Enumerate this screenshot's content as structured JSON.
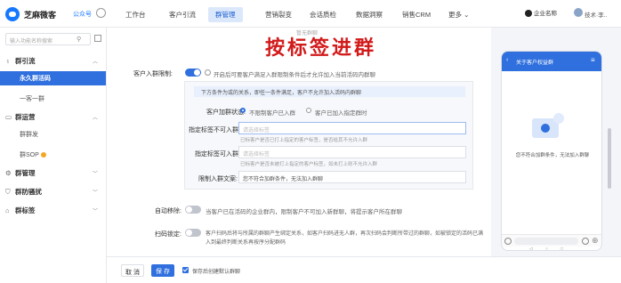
{
  "header": {
    "brand": "芝麻微客",
    "brand_sub": "公众号",
    "nav": [
      "工作台",
      "客户引流",
      "群管理",
      "营销裂变",
      "会话质检",
      "数据洞察",
      "销售CRM",
      "更多 ⌄"
    ],
    "active_nav_index": 2,
    "org": "企业名称",
    "username": "技术·李.."
  },
  "sidebar": {
    "search_placeholder": "输入功能名称搜索",
    "groups": [
      {
        "label": "群引流",
        "icon": "link-icon",
        "expanded": true,
        "items": [
          {
            "label": "永久群活码",
            "active": true
          },
          {
            "label": "一客一群",
            "active": false
          }
        ]
      },
      {
        "label": "群运营",
        "icon": "chat-icon",
        "expanded": true,
        "items": [
          {
            "label": "群群发",
            "active": false
          },
          {
            "label": "群SOP",
            "active": false
          }
        ]
      },
      {
        "label": "群管理",
        "icon": "gear-icon",
        "expanded": false,
        "items": []
      },
      {
        "label": "群防骚扰",
        "icon": "shield-icon",
        "expanded": false,
        "items": []
      },
      {
        "label": "群标签",
        "icon": "tag-icon",
        "expanded": false,
        "items": []
      }
    ]
  },
  "annotation": "按标签进群",
  "faint_label": "暂无群聊",
  "form": {
    "entry_limit": {
      "label": "客户入群限制:",
      "enabled": true,
      "hint": "开启后可要客户满足入群限制条件后才允许加入当前活码内群聊"
    },
    "panel_note": "下方条件为或的关系，即任一条件满足，客户不允许加入活码内群聊",
    "join_status": {
      "label": "客户加群状态:",
      "options": [
        "不限制客户已入群",
        "客户已加入指定群时"
      ],
      "selected": 0
    },
    "tag_not_allowed": {
      "label": "指定标签不可入群:",
      "placeholder": "请选择标签",
      "hint": "已标客户是否已打上指定的客户标签，是否给其不允许入群"
    },
    "tag_allowed": {
      "label": "指定标签可入群:",
      "placeholder": "请选择标签",
      "hint": "已标客户是否未被打上指定的客户标签，如未打上则不允许入群"
    },
    "deny_text": {
      "label": "限制入群文案:",
      "value": "您不符合加群条件，无法加入群聊"
    },
    "auto_remove": {
      "label": "自动移除:",
      "enabled": false,
      "hint": "当客户已在活码的企业群内，限制客户不可加入新群聊，将提示客户所在群聊"
    },
    "scan_lock": {
      "label": "扫码锁定:",
      "enabled": false,
      "hint_line1": "客户扫码后将与所属的群聊产生绑定关系，如客户扫码进无人群，再次扫码会判断所带过的群聊，如被锁定的活码已满",
      "hint_line2": "入到最终判断关系再按序分配群码"
    }
  },
  "phone": {
    "title": "关于客户权益群",
    "message": "您不符合加群条件，无法加入群聊"
  },
  "footer": {
    "cancel": "取 消",
    "save": "保 存",
    "checkbox_label": "保存后创建默认群聊",
    "checked": true
  }
}
